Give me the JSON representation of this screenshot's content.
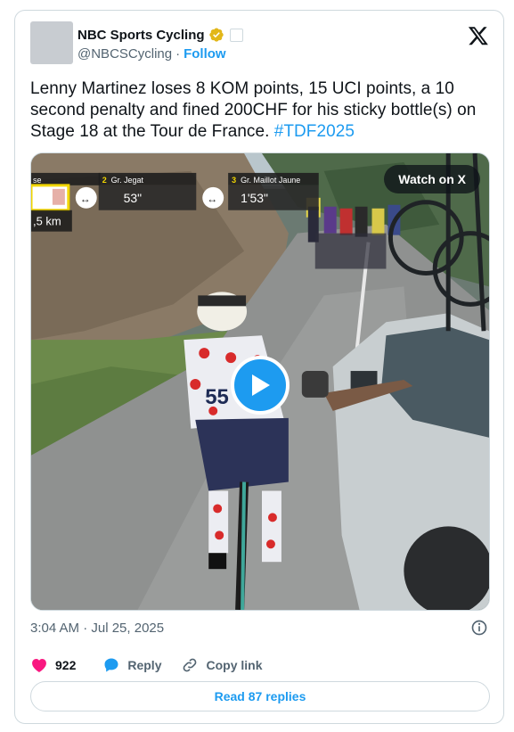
{
  "author": {
    "display_name": "NBC Sports Cycling",
    "handle": "@NBCSCycling",
    "separator": "·",
    "follow_label": "Follow"
  },
  "tweet": {
    "text": "Lenny Martinez loses 8 KOM points, 15 UCI points, a 10 second penalty and fined 200CHF for his sticky bottle(s) on Stage 18 at the Tour de France. ",
    "hashtag": "#TDF2025",
    "timestamp": "3:04 AM · Jul 25, 2025"
  },
  "media": {
    "watch_label": "Watch on X",
    "overlay": {
      "seg1_label": "se",
      "seg1_distance": ",5 km",
      "seg2_num": "2",
      "seg2_label": "Gr. Jegat",
      "seg2_time": "53\"",
      "seg3_num": "3",
      "seg3_label": "Gr. Maillot Jaune",
      "seg3_time": "1'53\"",
      "jersey_number": "55"
    }
  },
  "actions": {
    "likes": "922",
    "reply_label": "Reply",
    "copy_link_label": "Copy link"
  },
  "replies": {
    "label": "Read 87 replies"
  },
  "colors": {
    "accent": "#1d9bf0",
    "like": "#f91880",
    "verified_gold": "#e2b719",
    "muted": "#536471",
    "border": "#cfd9de"
  }
}
